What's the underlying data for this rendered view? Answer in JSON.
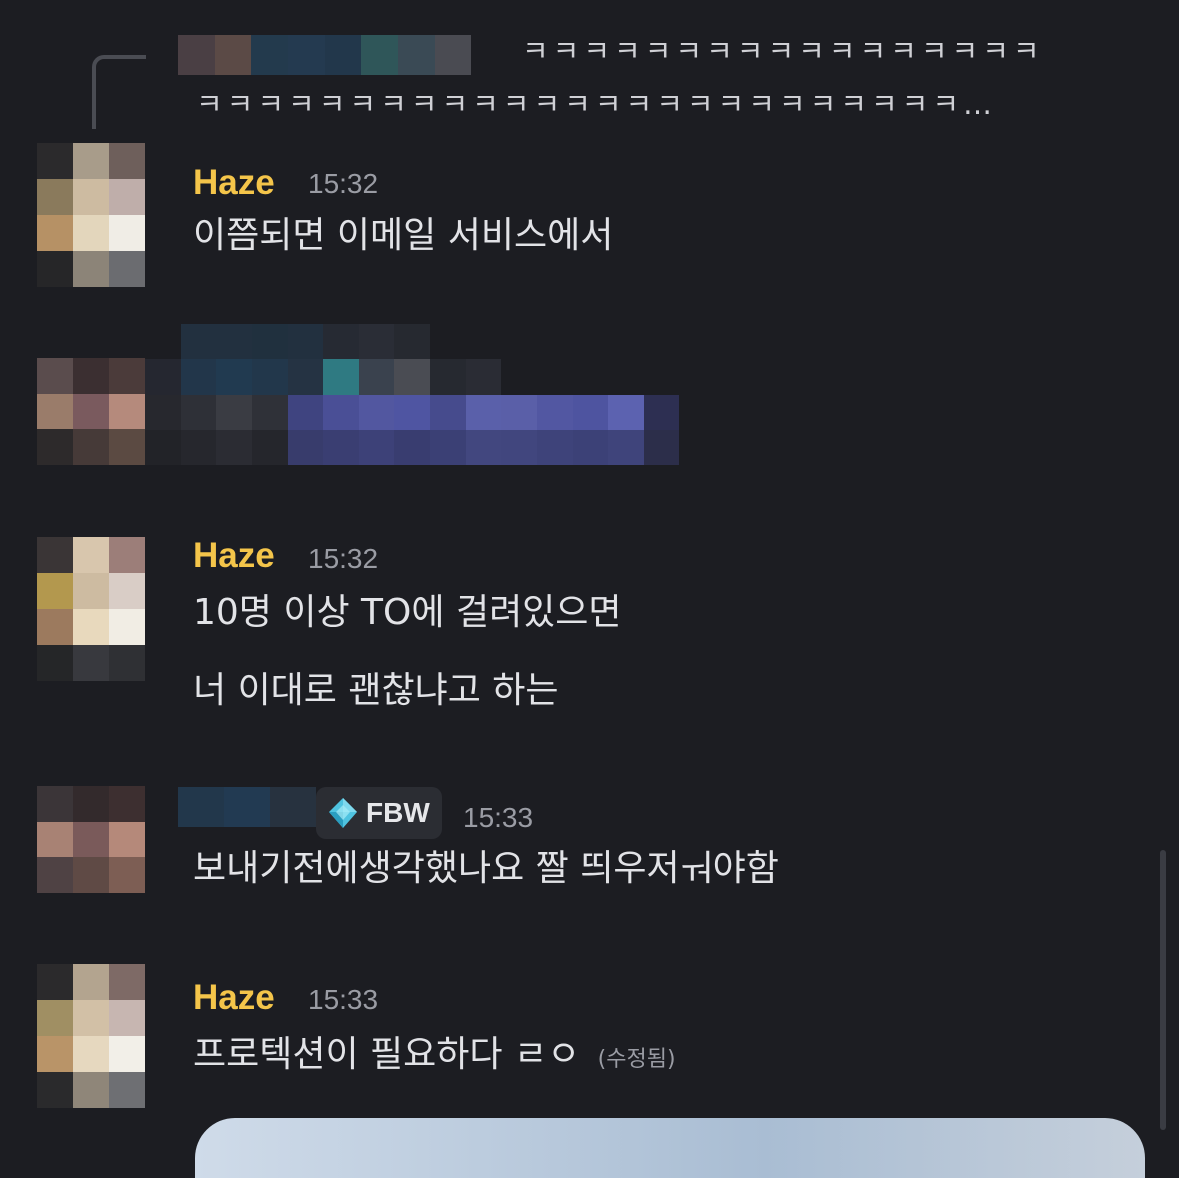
{
  "reply_preview": {
    "line1": "ㅋㅋㅋㅋㅋㅋㅋㅋㅋㅋㅋㅋㅋㅋㅋㅋㅋ",
    "line2": "ㅋㅋㅋㅋㅋㅋㅋㅋㅋㅋㅋㅋㅋㅋㅋㅋㅋㅋㅋㅋㅋㅋㅋㅋㅋ…"
  },
  "messages": [
    {
      "username": "Haze",
      "time": "15:32",
      "lines": [
        "이쯤되면 이메일 서비스에서"
      ]
    },
    {
      "username": "Haze",
      "time": "15:32",
      "lines": [
        "10명 이상 TO에 걸려있으면",
        "너 이대로 괜찮냐고 하는"
      ]
    },
    {
      "role_tag": "FBW",
      "time": "15:33",
      "lines": [
        "보내기전에생각했나요 짤 띄우저ㅝ야함"
      ]
    },
    {
      "username": "Haze",
      "time": "15:33",
      "lines": [
        "프로텍션이 필요하다 ㄹㅇ"
      ],
      "edited": "(수정됨)"
    }
  ],
  "icons": {
    "role": "diamond-icon"
  },
  "colors": {
    "background": "#1c1d22",
    "username": "#f4c54a",
    "timestamp": "#9a9ca4",
    "text": "#e2e3e7"
  }
}
